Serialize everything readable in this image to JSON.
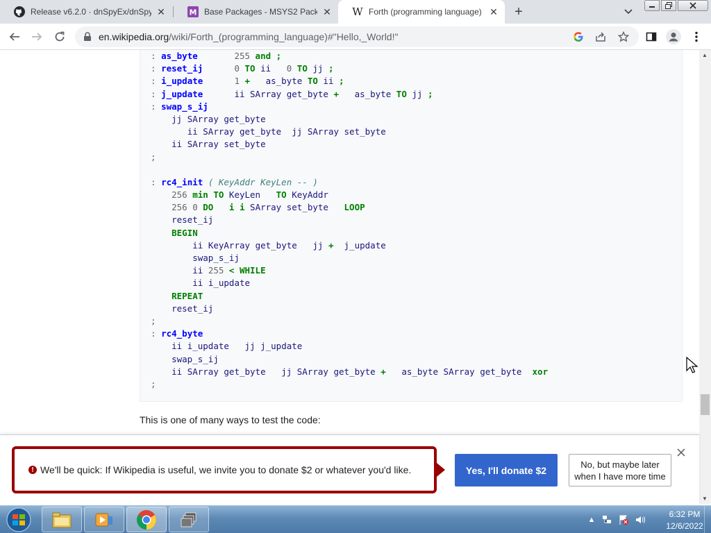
{
  "browser": {
    "tabs": [
      {
        "title": "Release v6.2.0 · dnSpyEx/dnSpy",
        "favicon": "github-icon",
        "active": false
      },
      {
        "title": "Base Packages - MSYS2 Packages",
        "favicon": "msys2-icon",
        "active": false
      },
      {
        "title": "Forth (programming language) -",
        "favicon": "wikipedia-icon",
        "active": true
      }
    ],
    "new_tab_label": "+",
    "url_domain": "en.wikipedia.org",
    "url_path": "/wiki/Forth_(programming_language)#\"Hello,_World!\""
  },
  "code_lines": [
    [
      {
        "t": ": ",
        "c": "p"
      },
      {
        "t": "as_byte",
        "c": "n"
      },
      {
        "t": "       ",
        "c": ""
      },
      {
        "t": "255",
        "c": "m"
      },
      {
        "t": " ",
        "c": ""
      },
      {
        "t": "and",
        "c": "k"
      },
      {
        "t": " ",
        "c": ""
      },
      {
        "t": ";",
        "c": "k"
      }
    ],
    [
      {
        "t": ": ",
        "c": "p"
      },
      {
        "t": "reset_ij",
        "c": "n"
      },
      {
        "t": "      ",
        "c": ""
      },
      {
        "t": "0",
        "c": "m"
      },
      {
        "t": " ",
        "c": ""
      },
      {
        "t": "TO",
        "c": "k"
      },
      {
        "t": " ",
        "c": ""
      },
      {
        "t": "ii",
        "c": "f"
      },
      {
        "t": "   ",
        "c": ""
      },
      {
        "t": "0",
        "c": "m"
      },
      {
        "t": " ",
        "c": ""
      },
      {
        "t": "TO",
        "c": "k"
      },
      {
        "t": " ",
        "c": ""
      },
      {
        "t": "jj",
        "c": "f"
      },
      {
        "t": " ",
        "c": ""
      },
      {
        "t": ";",
        "c": "k"
      }
    ],
    [
      {
        "t": ": ",
        "c": "p"
      },
      {
        "t": "i_update",
        "c": "n"
      },
      {
        "t": "      ",
        "c": ""
      },
      {
        "t": "1",
        "c": "m"
      },
      {
        "t": " ",
        "c": ""
      },
      {
        "t": "+",
        "c": "k"
      },
      {
        "t": "   ",
        "c": ""
      },
      {
        "t": "as_byte",
        "c": "f"
      },
      {
        "t": " ",
        "c": ""
      },
      {
        "t": "TO",
        "c": "k"
      },
      {
        "t": " ",
        "c": ""
      },
      {
        "t": "ii",
        "c": "f"
      },
      {
        "t": " ",
        "c": ""
      },
      {
        "t": ";",
        "c": "k"
      }
    ],
    [
      {
        "t": ": ",
        "c": "p"
      },
      {
        "t": "j_update",
        "c": "n"
      },
      {
        "t": "      ",
        "c": ""
      },
      {
        "t": "ii",
        "c": "f"
      },
      {
        "t": " ",
        "c": ""
      },
      {
        "t": "SArray",
        "c": "f"
      },
      {
        "t": " ",
        "c": ""
      },
      {
        "t": "get_byte",
        "c": "f"
      },
      {
        "t": " ",
        "c": ""
      },
      {
        "t": "+",
        "c": "k"
      },
      {
        "t": "   ",
        "c": ""
      },
      {
        "t": "as_byte",
        "c": "f"
      },
      {
        "t": " ",
        "c": ""
      },
      {
        "t": "TO",
        "c": "k"
      },
      {
        "t": " ",
        "c": ""
      },
      {
        "t": "jj",
        "c": "f"
      },
      {
        "t": " ",
        "c": ""
      },
      {
        "t": ";",
        "c": "k"
      }
    ],
    [
      {
        "t": ": ",
        "c": "p"
      },
      {
        "t": "swap_s_ij",
        "c": "n"
      }
    ],
    [
      {
        "t": "    ",
        "c": ""
      },
      {
        "t": "jj",
        "c": "f"
      },
      {
        "t": " ",
        "c": ""
      },
      {
        "t": "SArray",
        "c": "f"
      },
      {
        "t": " ",
        "c": ""
      },
      {
        "t": "get_byte",
        "c": "f"
      }
    ],
    [
      {
        "t": "       ",
        "c": ""
      },
      {
        "t": "ii",
        "c": "f"
      },
      {
        "t": " ",
        "c": ""
      },
      {
        "t": "SArray",
        "c": "f"
      },
      {
        "t": " ",
        "c": ""
      },
      {
        "t": "get_byte",
        "c": "f"
      },
      {
        "t": "  ",
        "c": ""
      },
      {
        "t": "jj",
        "c": "f"
      },
      {
        "t": " ",
        "c": ""
      },
      {
        "t": "SArray",
        "c": "f"
      },
      {
        "t": " ",
        "c": ""
      },
      {
        "t": "set_byte",
        "c": "f"
      }
    ],
    [
      {
        "t": "    ",
        "c": ""
      },
      {
        "t": "ii",
        "c": "f"
      },
      {
        "t": " ",
        "c": ""
      },
      {
        "t": "SArray",
        "c": "f"
      },
      {
        "t": " ",
        "c": ""
      },
      {
        "t": "set_byte",
        "c": "f"
      }
    ],
    [
      {
        "t": ";",
        "c": "p"
      }
    ],
    [],
    [
      {
        "t": ": ",
        "c": "p"
      },
      {
        "t": "rc4_init",
        "c": "n"
      },
      {
        "t": " ",
        "c": ""
      },
      {
        "t": "( KeyAddr KeyLen -- )",
        "c": "c"
      }
    ],
    [
      {
        "t": "    ",
        "c": ""
      },
      {
        "t": "256",
        "c": "m"
      },
      {
        "t": " ",
        "c": ""
      },
      {
        "t": "min",
        "c": "k"
      },
      {
        "t": " ",
        "c": ""
      },
      {
        "t": "TO",
        "c": "k"
      },
      {
        "t": " ",
        "c": ""
      },
      {
        "t": "KeyLen",
        "c": "f"
      },
      {
        "t": "   ",
        "c": ""
      },
      {
        "t": "TO",
        "c": "k"
      },
      {
        "t": " ",
        "c": ""
      },
      {
        "t": "KeyAddr",
        "c": "f"
      }
    ],
    [
      {
        "t": "    ",
        "c": ""
      },
      {
        "t": "256",
        "c": "m"
      },
      {
        "t": " ",
        "c": ""
      },
      {
        "t": "0",
        "c": "m"
      },
      {
        "t": " ",
        "c": ""
      },
      {
        "t": "DO",
        "c": "k"
      },
      {
        "t": "   ",
        "c": ""
      },
      {
        "t": "i",
        "c": "k"
      },
      {
        "t": " ",
        "c": ""
      },
      {
        "t": "i",
        "c": "k"
      },
      {
        "t": " ",
        "c": ""
      },
      {
        "t": "SArray",
        "c": "f"
      },
      {
        "t": " ",
        "c": ""
      },
      {
        "t": "set_byte",
        "c": "f"
      },
      {
        "t": "   ",
        "c": ""
      },
      {
        "t": "LOOP",
        "c": "k"
      }
    ],
    [
      {
        "t": "    ",
        "c": ""
      },
      {
        "t": "reset_ij",
        "c": "f"
      }
    ],
    [
      {
        "t": "    ",
        "c": ""
      },
      {
        "t": "BEGIN",
        "c": "k"
      }
    ],
    [
      {
        "t": "        ",
        "c": ""
      },
      {
        "t": "ii",
        "c": "f"
      },
      {
        "t": " ",
        "c": ""
      },
      {
        "t": "KeyArray",
        "c": "f"
      },
      {
        "t": " ",
        "c": ""
      },
      {
        "t": "get_byte",
        "c": "f"
      },
      {
        "t": "   ",
        "c": ""
      },
      {
        "t": "jj",
        "c": "f"
      },
      {
        "t": " ",
        "c": ""
      },
      {
        "t": "+",
        "c": "k"
      },
      {
        "t": "  ",
        "c": ""
      },
      {
        "t": "j_update",
        "c": "f"
      }
    ],
    [
      {
        "t": "        ",
        "c": ""
      },
      {
        "t": "swap_s_ij",
        "c": "f"
      }
    ],
    [
      {
        "t": "        ",
        "c": ""
      },
      {
        "t": "ii",
        "c": "f"
      },
      {
        "t": " ",
        "c": ""
      },
      {
        "t": "255",
        "c": "m"
      },
      {
        "t": " ",
        "c": ""
      },
      {
        "t": "<",
        "c": "k"
      },
      {
        "t": " ",
        "c": ""
      },
      {
        "t": "WHILE",
        "c": "k"
      }
    ],
    [
      {
        "t": "        ",
        "c": ""
      },
      {
        "t": "ii",
        "c": "f"
      },
      {
        "t": " ",
        "c": ""
      },
      {
        "t": "i_update",
        "c": "f"
      }
    ],
    [
      {
        "t": "    ",
        "c": ""
      },
      {
        "t": "REPEAT",
        "c": "k"
      }
    ],
    [
      {
        "t": "    ",
        "c": ""
      },
      {
        "t": "reset_ij",
        "c": "f"
      }
    ],
    [
      {
        "t": ";",
        "c": "p"
      }
    ],
    [
      {
        "t": ": ",
        "c": "p"
      },
      {
        "t": "rc4_byte",
        "c": "n"
      }
    ],
    [
      {
        "t": "    ",
        "c": ""
      },
      {
        "t": "ii",
        "c": "f"
      },
      {
        "t": " ",
        "c": ""
      },
      {
        "t": "i_update",
        "c": "f"
      },
      {
        "t": "   ",
        "c": ""
      },
      {
        "t": "jj",
        "c": "f"
      },
      {
        "t": " ",
        "c": ""
      },
      {
        "t": "j_update",
        "c": "f"
      }
    ],
    [
      {
        "t": "    ",
        "c": ""
      },
      {
        "t": "swap_s_ij",
        "c": "f"
      }
    ],
    [
      {
        "t": "    ",
        "c": ""
      },
      {
        "t": "ii",
        "c": "f"
      },
      {
        "t": " ",
        "c": ""
      },
      {
        "t": "SArray",
        "c": "f"
      },
      {
        "t": " ",
        "c": ""
      },
      {
        "t": "get_byte",
        "c": "f"
      },
      {
        "t": "   ",
        "c": ""
      },
      {
        "t": "jj",
        "c": "f"
      },
      {
        "t": " ",
        "c": ""
      },
      {
        "t": "SArray",
        "c": "f"
      },
      {
        "t": " ",
        "c": ""
      },
      {
        "t": "get_byte",
        "c": "f"
      },
      {
        "t": " ",
        "c": ""
      },
      {
        "t": "+",
        "c": "k"
      },
      {
        "t": "   ",
        "c": ""
      },
      {
        "t": "as_byte",
        "c": "f"
      },
      {
        "t": " ",
        "c": ""
      },
      {
        "t": "SArray",
        "c": "f"
      },
      {
        "t": " ",
        "c": ""
      },
      {
        "t": "get_byte",
        "c": "f"
      },
      {
        "t": "  ",
        "c": ""
      },
      {
        "t": "xor",
        "c": "k"
      }
    ],
    [
      {
        "t": ";",
        "c": "p"
      }
    ]
  ],
  "article": {
    "after_code_text": "This is one of many ways to test the code:"
  },
  "donation_banner": {
    "message": "We'll be quick: If Wikipedia is useful, we invite you to donate $2 or whatever you'd like.",
    "donate_button": "Yes, I'll donate $2",
    "later_button_line1": "No, but maybe later",
    "later_button_line2": "when I have more time",
    "accent_color": "#990000",
    "button_color": "#3366cc"
  },
  "taskbar": {
    "time": "6:32 PM",
    "date": "12/6/2022",
    "pinned_apps": [
      "windows-explorer-icon",
      "media-player-icon",
      "chrome-icon",
      "window-switcher-icon"
    ]
  }
}
